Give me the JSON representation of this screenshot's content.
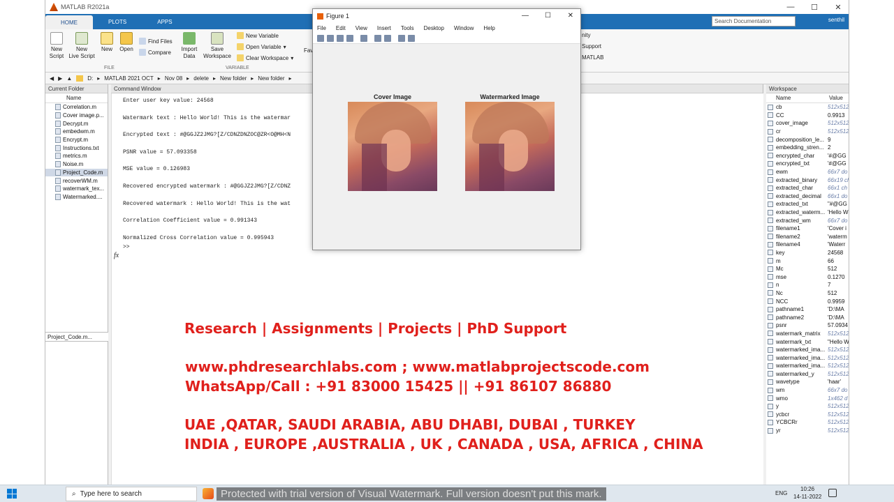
{
  "app": {
    "title": "MATLAB R2021a",
    "user": "senthil",
    "search_placeholder": "Search Documentation"
  },
  "ribbon": {
    "tabs": [
      "HOME",
      "PLOTS",
      "APPS"
    ],
    "buttons": {
      "new_script": "New\nScript",
      "new_live_script": "New\nLive Script",
      "new": "New",
      "open": "Open",
      "find_files": "Find Files",
      "compare": "Compare",
      "import_data": "Import\nData",
      "save_workspace": "Save\nWorkspace",
      "new_variable": "New Variable",
      "open_variable": "Open Variable",
      "clear_workspace": "Clear Workspace",
      "fav": "Fav",
      "community": "nity",
      "support": "Support",
      "matlab": "MATLAB"
    },
    "groups": {
      "file": "FILE",
      "variable": "VARIABLE"
    }
  },
  "address": {
    "crumbs": [
      "D:",
      "MATLAB 2021 OCT",
      "Nov 08",
      "delete",
      "New folder",
      "New folder"
    ]
  },
  "current_folder": {
    "title": "Current Folder",
    "column": "Name",
    "files": [
      "Correlation.m",
      "Cover image.p...",
      "Decrypt.m",
      "embedwm.m",
      "Encrypt.m",
      "Instructions.txt",
      "metrics.m",
      "Noise.m",
      "Project_Code.m",
      "recoverWM.m",
      "watermark_tex...",
      "Watermarked...."
    ],
    "selected": "Project_Code.m",
    "details": "Project_Code.m..."
  },
  "command_window": {
    "title": "Command Window",
    "lines": [
      "Enter user key value: 24568",
      "Watermark text : Hello World! This is the watermar",
      "Encrypted text : #@GGJZ2JMG?[Z/CDNZDNZOC@ZR<O@MH<N",
      "PSNR value = 57.093358",
      "MSE value = 0.126983",
      "Recovered encrypted watermark : #@GGJZ2JMG?[Z/CDNZ",
      "Recovered watermark : Hello World! This is the wat",
      "Correlation Coefficient value = 0.991343",
      "Normalized Cross Correlation value = 0.995943"
    ],
    "fx": "fx",
    "prompt": ">>"
  },
  "workspace": {
    "title": "Workspace",
    "col_name": "Name",
    "col_value": "Value",
    "vars": [
      {
        "n": "cb",
        "v": "512x512",
        "it": true
      },
      {
        "n": "CC",
        "v": "0.9913",
        "it": false
      },
      {
        "n": "cover_image",
        "v": "512x512",
        "it": true
      },
      {
        "n": "cr",
        "v": "512x512",
        "it": true
      },
      {
        "n": "decomposition_le...",
        "v": "9",
        "it": false
      },
      {
        "n": "embedding_stren...",
        "v": "2",
        "it": false
      },
      {
        "n": "encrypted_char",
        "v": "'#@GG",
        "it": false
      },
      {
        "n": "encrypted_txt",
        "v": "'#@GG",
        "it": false
      },
      {
        "n": "ewm",
        "v": "66x7 do",
        "it": true
      },
      {
        "n": "extracted_binary",
        "v": "66x19 ch",
        "it": true
      },
      {
        "n": "extracted_char",
        "v": "66x1 ch",
        "it": true
      },
      {
        "n": "extracted_decimal",
        "v": "66x1 do",
        "it": true
      },
      {
        "n": "extracted_txt",
        "v": "\"#@GG",
        "it": false
      },
      {
        "n": "extracted_waterm...",
        "v": "'Hello W",
        "it": false
      },
      {
        "n": "extracted_wm",
        "v": "66x7 do",
        "it": true
      },
      {
        "n": "filename1",
        "v": "'Cover i",
        "it": false
      },
      {
        "n": "filename2",
        "v": "'waterm",
        "it": false
      },
      {
        "n": "filename4",
        "v": "'Waterr",
        "it": false
      },
      {
        "n": "key",
        "v": "24568",
        "it": false
      },
      {
        "n": "m",
        "v": "66",
        "it": false
      },
      {
        "n": "Mc",
        "v": "512",
        "it": false
      },
      {
        "n": "mse",
        "v": "0.1270",
        "it": false
      },
      {
        "n": "n",
        "v": "7",
        "it": false
      },
      {
        "n": "Nc",
        "v": "512",
        "it": false
      },
      {
        "n": "NCC",
        "v": "0.9959",
        "it": false
      },
      {
        "n": "pathname1",
        "v": "'D:\\MA",
        "it": false
      },
      {
        "n": "pathname2",
        "v": "'D:\\MA",
        "it": false
      },
      {
        "n": "psnr",
        "v": "57.0934",
        "it": false
      },
      {
        "n": "watermark_matrix",
        "v": "512x512",
        "it": true
      },
      {
        "n": "watermark_txt",
        "v": "\"Hello W",
        "it": false
      },
      {
        "n": "watermarked_ima...",
        "v": "512x512",
        "it": true
      },
      {
        "n": "watermarked_ima...",
        "v": "512x512",
        "it": true
      },
      {
        "n": "watermarked_ima...",
        "v": "512x512",
        "it": true
      },
      {
        "n": "watermarked_y",
        "v": "512x512",
        "it": true
      },
      {
        "n": "wavetype",
        "v": "'haar'",
        "it": false
      },
      {
        "n": "wm",
        "v": "66x7 do",
        "it": true
      },
      {
        "n": "wmo",
        "v": "1x462 d",
        "it": true
      },
      {
        "n": "y",
        "v": "512x512",
        "it": true
      },
      {
        "n": "ycbcr",
        "v": "512x512",
        "it": true
      },
      {
        "n": "YCBCRr",
        "v": "512x512",
        "it": true
      },
      {
        "n": "yr",
        "v": "512x512",
        "it": true
      }
    ]
  },
  "figure": {
    "title": "Figure 1",
    "menu": [
      "File",
      "Edit",
      "View",
      "Insert",
      "Tools",
      "Desktop",
      "Window",
      "Help"
    ],
    "left_title": "Cover Image",
    "right_title": "Watermarked Image"
  },
  "promo": {
    "line1": "Research | Assignments | Projects | PhD Support",
    "line2": "www.phdresearchlabs.com ; www.matlabprojectscode.com",
    "line3": "WhatsApp/Call : +91 83000 15425 || +91 86107 86880",
    "line4": "UAE ,QATAR, SAUDI ARABIA, ABU DHABI, DUBAI , TURKEY",
    "line5": "INDIA , EUROPE ,AUSTRALIA , UK , CANADA , USA, AFRICA , CHINA"
  },
  "taskbar": {
    "search": "Type here to search",
    "watermark": "Protected with trial version of Visual Watermark. Full version doesn't put this mark.",
    "lang": "ENG",
    "time": "10:26",
    "date": "14-11-2022"
  },
  "colors": {
    "ribbon_blue": "#1f6fb5",
    "promo_red": "#e0201c"
  }
}
